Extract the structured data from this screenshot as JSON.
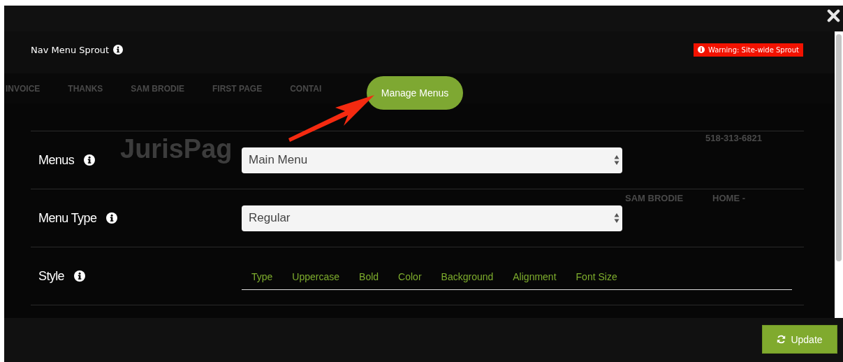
{
  "header": {
    "title": "Nav Menu Sprout",
    "warning": "Warning: Site-wide Sprout"
  },
  "background": {
    "logo": "JurisPag",
    "nav_items": [
      "INVOICE",
      "THANKS",
      "SAM BRODIE",
      "FIRST PAGE",
      "CONTAI"
    ],
    "phone": "518-313-6821",
    "links": [
      "SAM BRODIE",
      "HOME -"
    ]
  },
  "manage_button": "Manage Menus",
  "fields": [
    {
      "kind": "select",
      "label": "Menus",
      "value": "Main Menu"
    },
    {
      "kind": "select",
      "label": "Menu Type",
      "value": "Regular"
    },
    {
      "kind": "tabs",
      "label": "Style",
      "tabs": [
        "Type",
        "Uppercase",
        "Bold",
        "Color",
        "Background",
        "Alignment",
        "Font Size"
      ]
    }
  ],
  "update_button": "Update"
}
